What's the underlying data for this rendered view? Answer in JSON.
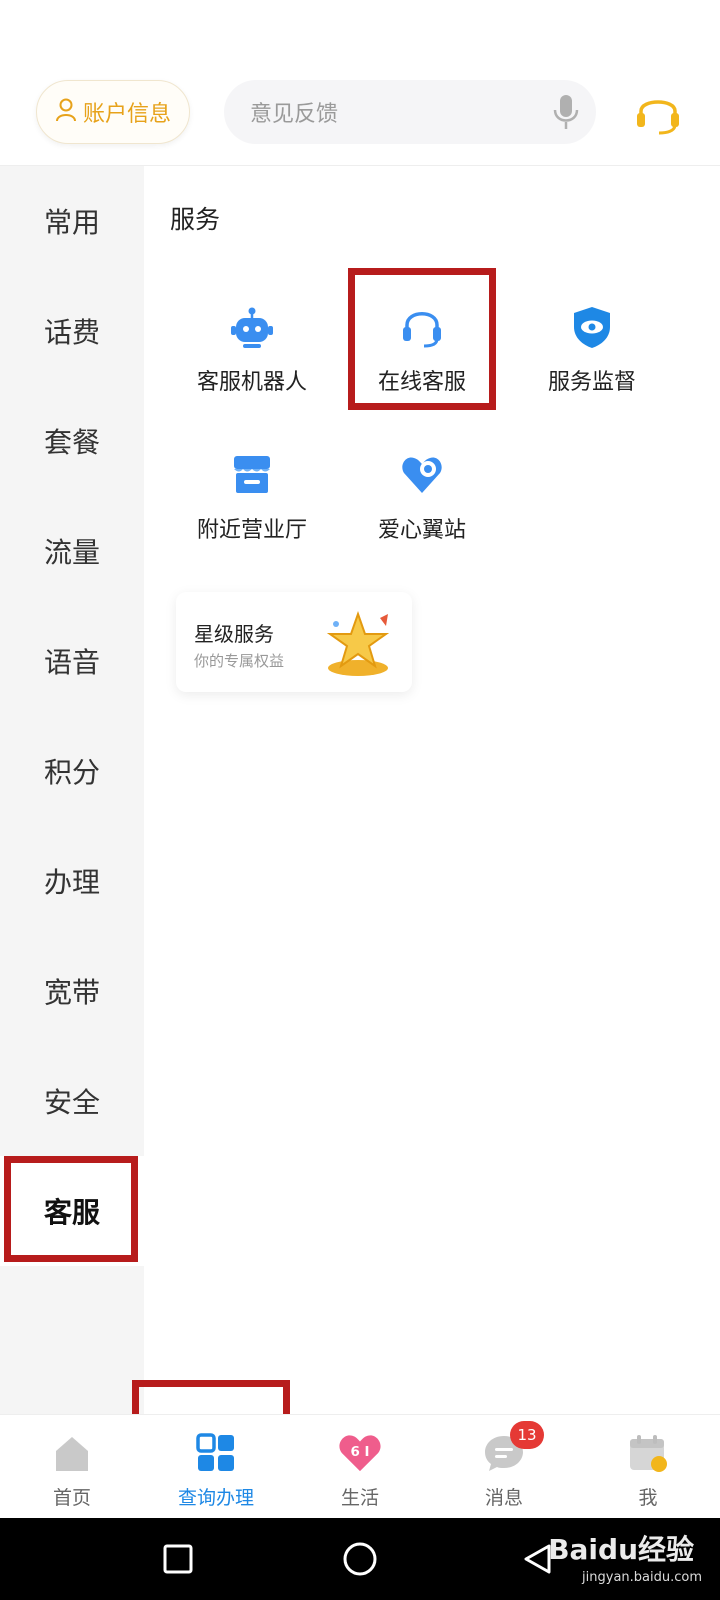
{
  "header": {
    "account_label": "账户信息",
    "search_placeholder": "意见反馈"
  },
  "sidebar": {
    "items": [
      {
        "label": "常用"
      },
      {
        "label": "话费"
      },
      {
        "label": "套餐"
      },
      {
        "label": "流量"
      },
      {
        "label": "语音"
      },
      {
        "label": "积分"
      },
      {
        "label": "办理"
      },
      {
        "label": "宽带"
      },
      {
        "label": "安全"
      },
      {
        "label": "客服"
      }
    ],
    "active_index": 9
  },
  "main": {
    "section_title": "服务",
    "services": [
      {
        "label": "客服机器人",
        "icon": "robot-icon"
      },
      {
        "label": "在线客服",
        "icon": "headset-icon"
      },
      {
        "label": "服务监督",
        "icon": "shield-eye-icon"
      },
      {
        "label": "附近营业厅",
        "icon": "store-icon"
      },
      {
        "label": "爱心翼站",
        "icon": "heart-location-icon"
      }
    ],
    "star_card": {
      "title": "星级服务",
      "subtitle": "你的专属权益"
    }
  },
  "bottom_nav": {
    "tabs": [
      {
        "label": "首页",
        "icon": "home-icon"
      },
      {
        "label": "查询办理",
        "icon": "grid-icon"
      },
      {
        "label": "生活",
        "icon": "heart-61-icon"
      },
      {
        "label": "消息",
        "icon": "message-icon",
        "badge": "13"
      },
      {
        "label": "我",
        "icon": "calendar-sign-icon"
      }
    ],
    "active_index": 1
  },
  "colors": {
    "accent_blue": "#1e88e5",
    "gold": "#e7a21a",
    "highlight_red": "#b71c1c",
    "badge_red": "#e53935"
  },
  "watermark": {
    "brand": "Baidu经验",
    "url": "jingyan.baidu.com"
  }
}
